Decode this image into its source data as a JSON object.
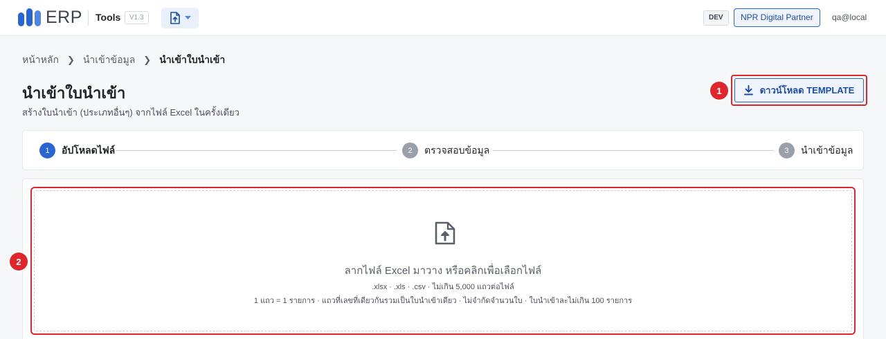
{
  "header": {
    "logo_text": "ERP",
    "app_name": "Tools",
    "version": "V1.3",
    "tool_icon": "file-upload-icon",
    "env_badge": "DEV",
    "partner_button": "NPR Digital Partner",
    "user": "qa@local",
    "brand_color": "#2a66d3"
  },
  "breadcrumb": {
    "items": [
      "หน้าหลัก",
      "นำเข้าข้อมูล",
      "นำเข้าใบนำเข้า"
    ]
  },
  "page": {
    "title": "นำเข้าใบนำเข้า",
    "subtitle": "สร้างใบนำเข้า (ประเภทอื่นๆ) จากไฟล์ Excel ในครั้งเดียว",
    "download_label": "ดาวน์โหลด TEMPLATE"
  },
  "annotations": {
    "marker_1": "1",
    "marker_2": "2",
    "color": "#e0262c"
  },
  "stepper": {
    "steps": [
      {
        "number": "1",
        "label": "อัปโหลดไฟล์",
        "state": "active"
      },
      {
        "number": "2",
        "label": "ตรวจสอบข้อมูล",
        "state": "pending"
      },
      {
        "number": "3",
        "label": "นำเข้าข้อมูล",
        "state": "pending"
      }
    ],
    "active_color": "#2a66d3",
    "pending_color": "#9aa0a8"
  },
  "upload": {
    "icon": "file-upload-icon",
    "title": "ลากไฟล์ Excel มาวาง หรือคลิกเพื่อเลือกไฟล์",
    "formats": ".xlsx · .xls · .csv · ไม่เกิน 5,000 แถวต่อไฟล์",
    "rules": "1 แถว = 1 รายการ · แถวที่เลขที่เดียวกันรวมเป็นใบนำเข้าเดียว · ไม่จำกัดจำนวนใบ · ใบนำเข้าละไม่เกิน 100 รายการ"
  }
}
